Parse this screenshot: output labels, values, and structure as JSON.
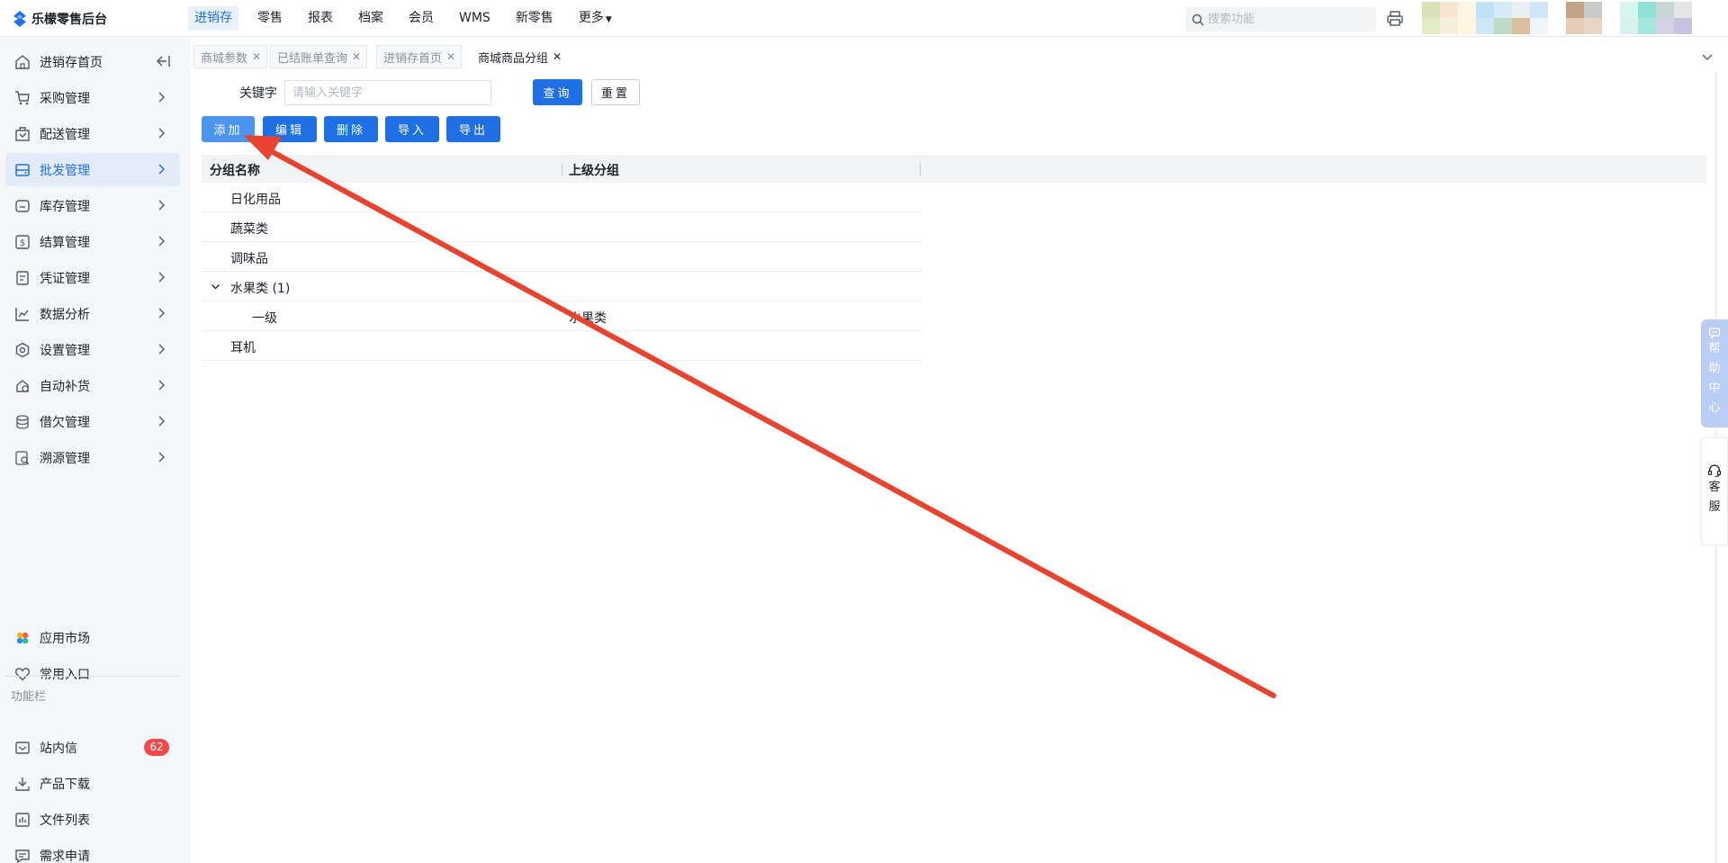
{
  "app": {
    "title": "乐檬零售后台"
  },
  "topnav": {
    "items": [
      {
        "label": "进销存",
        "active": true
      },
      {
        "label": "零售"
      },
      {
        "label": "报表"
      },
      {
        "label": "档案"
      },
      {
        "label": "会员"
      },
      {
        "label": "WMS"
      },
      {
        "label": "新零售"
      },
      {
        "label": "更多"
      }
    ],
    "search_placeholder": "搜索功能"
  },
  "sidebar": {
    "items": [
      {
        "label": "进销存首页",
        "icon": "home-icon"
      },
      {
        "label": "采购管理",
        "icon": "cart-icon"
      },
      {
        "label": "配送管理",
        "icon": "delivery-icon"
      },
      {
        "label": "批发管理",
        "icon": "wholesale-icon",
        "active": true
      },
      {
        "label": "库存管理",
        "icon": "inventory-icon"
      },
      {
        "label": "结算管理",
        "icon": "settlement-icon"
      },
      {
        "label": "凭证管理",
        "icon": "voucher-icon"
      },
      {
        "label": "数据分析",
        "icon": "chart-icon"
      },
      {
        "label": "设置管理",
        "icon": "settings-icon"
      },
      {
        "label": "自动补货",
        "icon": "restock-icon"
      },
      {
        "label": "借欠管理",
        "icon": "debt-icon"
      },
      {
        "label": "溯源管理",
        "icon": "trace-icon"
      }
    ],
    "bottom_items": [
      {
        "label": "应用市场",
        "icon": "app-market-icon"
      },
      {
        "label": "常用入口",
        "icon": "heart-icon"
      }
    ],
    "section_title": "功能栏",
    "func_items": [
      {
        "label": "站内信",
        "icon": "mail-icon",
        "badge": "62"
      },
      {
        "label": "产品下载",
        "icon": "download-icon"
      },
      {
        "label": "文件列表",
        "icon": "file-list-icon"
      },
      {
        "label": "需求申请",
        "icon": "request-icon"
      }
    ]
  },
  "tabs": [
    {
      "label": "商城参数"
    },
    {
      "label": "已结账单查询"
    },
    {
      "label": "进销存首页"
    },
    {
      "label": "商城商品分组",
      "active": true
    }
  ],
  "filter": {
    "keyword_label": "关键字",
    "keyword_placeholder": "请输入关键字",
    "query_button": "查询",
    "reset_button": "重置"
  },
  "toolbar": {
    "add": "添加",
    "edit": "编辑",
    "delete": "删除",
    "import": "导入",
    "export": "导出"
  },
  "table": {
    "columns": [
      "分组名称",
      "上级分组"
    ],
    "rows": [
      {
        "name": "日化用品",
        "parent": ""
      },
      {
        "name": "蔬菜类",
        "parent": ""
      },
      {
        "name": "调味品",
        "parent": ""
      },
      {
        "name": "水果类 (1)",
        "parent": "",
        "expanded": true
      },
      {
        "name": "一级",
        "parent": "水果类",
        "child": true
      },
      {
        "name": "耳机",
        "parent": ""
      }
    ]
  },
  "floating": {
    "help_label": [
      "帮",
      "助",
      "中",
      "心"
    ],
    "cs_label": [
      "客",
      "服"
    ]
  },
  "colors": {
    "primary": "#1f6fe5",
    "add_button": "#4b95f0",
    "badge": "#f5484a",
    "annotation_arrow": "#e8432e"
  }
}
